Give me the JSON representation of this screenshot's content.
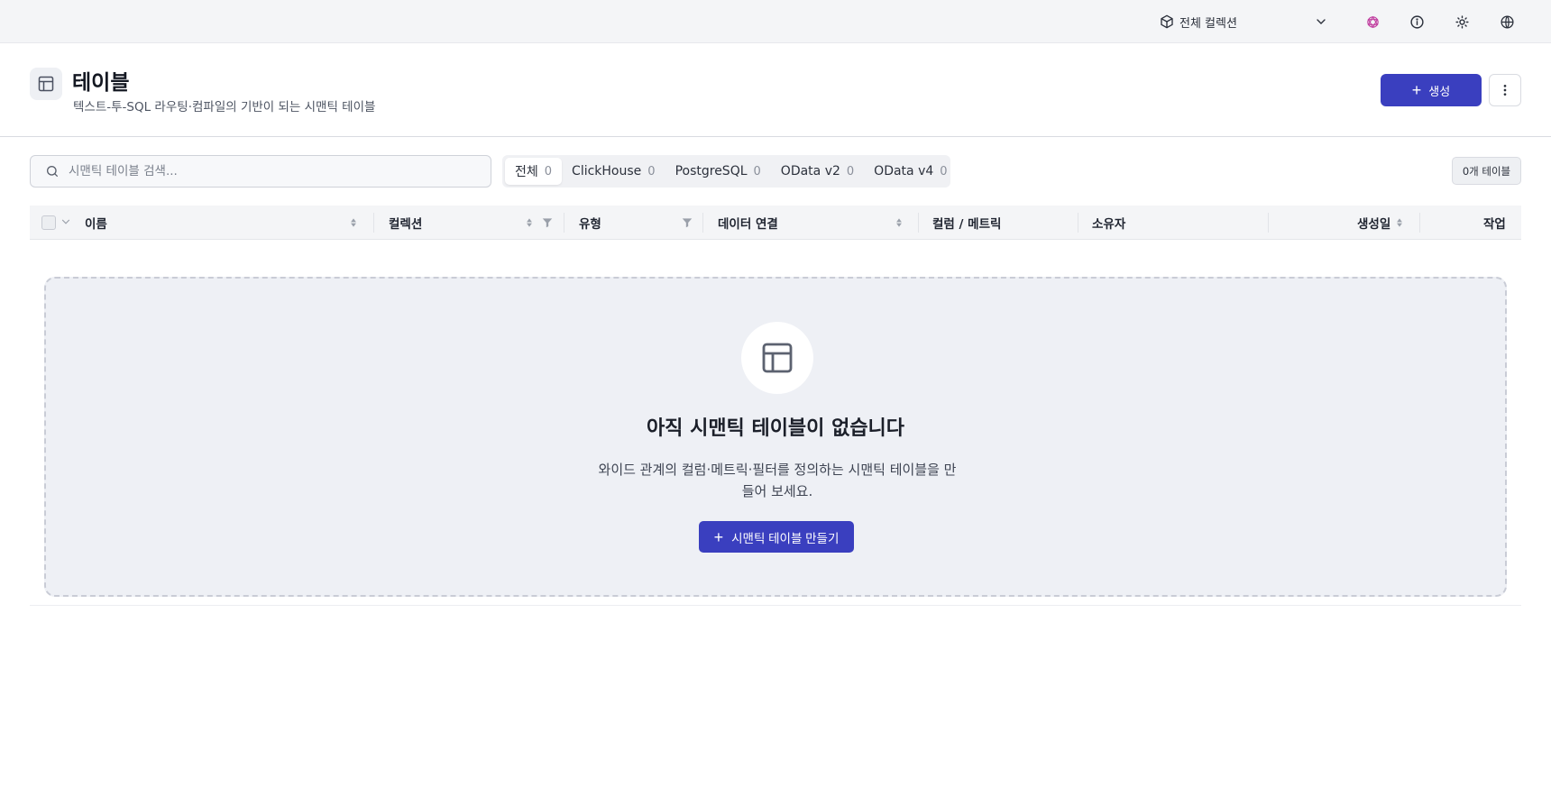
{
  "topbar": {
    "collection_label": "전체 컬렉션",
    "icons": [
      "box-icon",
      "chevron-down-icon",
      "logo-icon",
      "info-icon",
      "sun-icon",
      "globe-icon"
    ]
  },
  "header": {
    "title": "테이블",
    "subtitle": "텍스트-투-SQL 라우팅·컴파일의 기반이 되는 시맨틱 테이블",
    "create_label": "생성"
  },
  "toolbar": {
    "search_placeholder": "시맨틱 테이블 검색...",
    "tabs": [
      {
        "label": "전체",
        "count": "0"
      },
      {
        "label": "ClickHouse",
        "count": "0"
      },
      {
        "label": "PostgreSQL",
        "count": "0"
      },
      {
        "label": "OData v2",
        "count": "0"
      },
      {
        "label": "OData v4",
        "count": "0"
      }
    ],
    "table_count": "0개 테이블"
  },
  "table": {
    "columns": {
      "name": "이름",
      "collection": "컬렉션",
      "type": "유형",
      "data_connection": "데이터 연결",
      "columns_metrics": "컬럼 / 메트릭",
      "owner": "소유자",
      "created": "생성일",
      "actions": "작업"
    }
  },
  "empty_state": {
    "title": "아직 시맨틱 테이블이 없습니다",
    "description": "와이드 관계의 컬럼·메트릭·필터를 정의하는 시맨틱 테이블을 만들어 보세요.",
    "button_label": "시맨틱 테이블 만들기"
  },
  "colors": {
    "accent": "#3a3fbf",
    "logo": "#c13fa0"
  }
}
